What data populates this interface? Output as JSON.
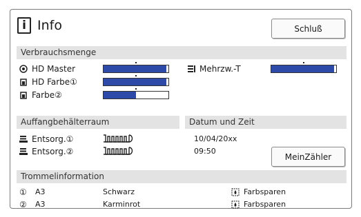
{
  "header": {
    "title": "Info",
    "close_label": "Schluß"
  },
  "consumables": {
    "heading": "Verbrauchsmenge",
    "items": [
      {
        "label": "HD Master",
        "icon": "master-icon",
        "level": 0.97
      },
      {
        "label": "HD Farbe①",
        "icon": "ink-icon",
        "level": 0.97
      },
      {
        "label": "Farbe②",
        "icon": "ink-icon",
        "level": 0.5
      }
    ],
    "multi": {
      "label": "Mehrzw.-T",
      "icon": "multi-tray-icon",
      "level": 0.97
    }
  },
  "waste": {
    "heading": "Auffangbehälterraum",
    "items": [
      {
        "label": "Entsorg.①",
        "icon": "waste-box-icon",
        "gauge_icon": "waste-gauge-icon"
      },
      {
        "label": "Entsorg.②",
        "icon": "waste-box-icon",
        "gauge_icon": "waste-gauge-icon"
      }
    ]
  },
  "datetime": {
    "heading": "Datum und Zeit",
    "date": "10/04/20xx",
    "time": "09:50",
    "counter_button": "MeinZähler"
  },
  "drums": {
    "heading": "Trommelinformation",
    "items": [
      {
        "index": "①",
        "size": "A3",
        "color": "Schwarz",
        "mode": "Farbsparen"
      },
      {
        "index": "②",
        "size": "A3",
        "color": "Karminrot",
        "mode": "Farbsparen"
      }
    ]
  },
  "colors": {
    "meter_fill": "#2e4aa8",
    "section_bg": "#e3e3e3"
  }
}
